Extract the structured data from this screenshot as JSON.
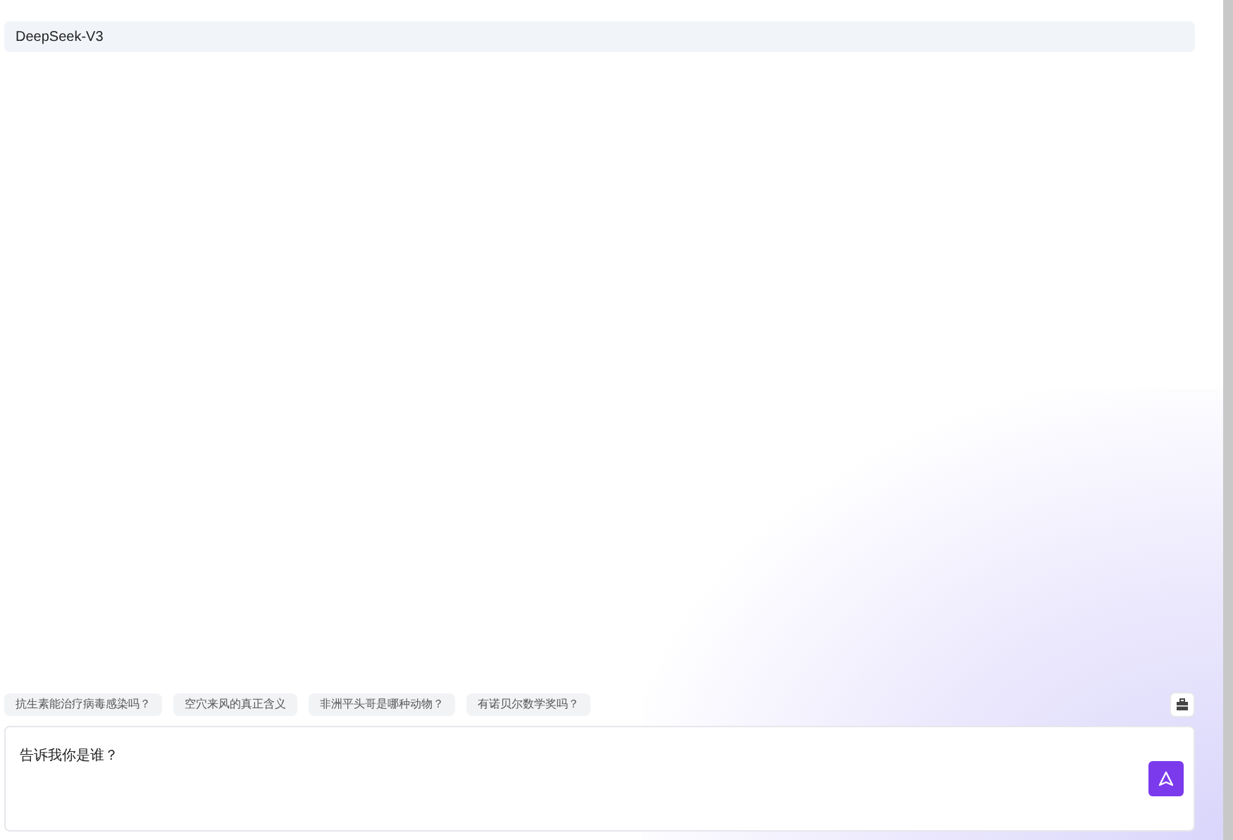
{
  "header": {
    "title": "DeepSeek-V3"
  },
  "suggestions": [
    "抗生素能治疗病毒感染吗？",
    "空穴来风的真正含义",
    "非洲平头哥是哪种动物？",
    "有诺贝尔数学奖吗？"
  ],
  "input": {
    "value": "告诉我你是谁？"
  }
}
